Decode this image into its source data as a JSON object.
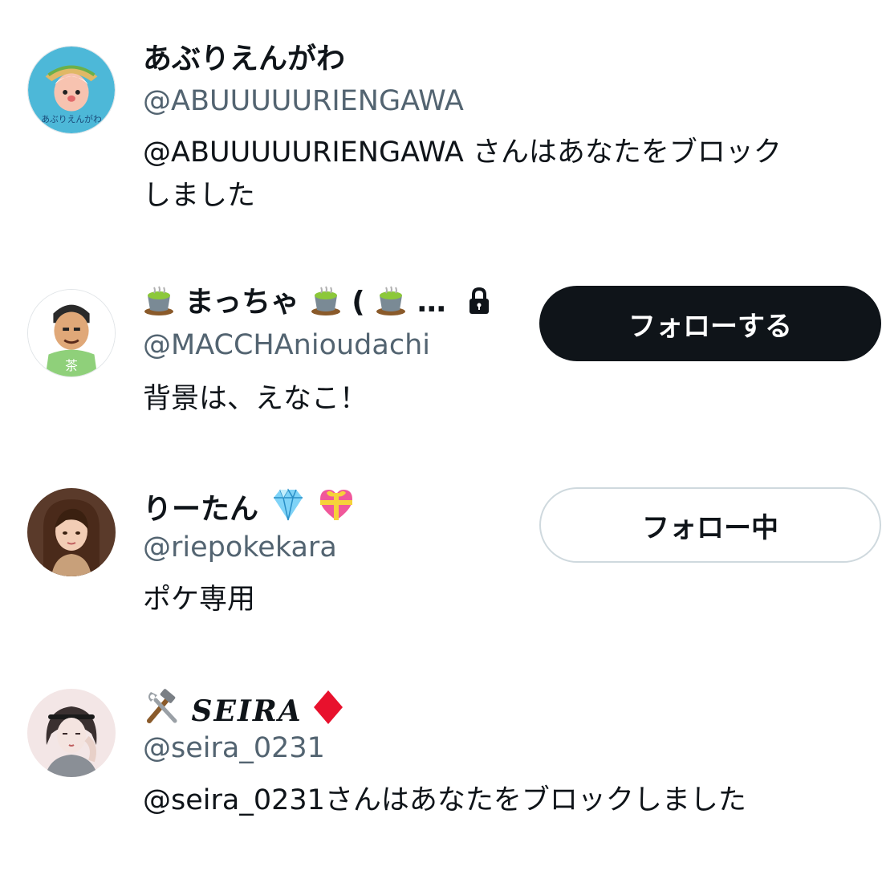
{
  "users": [
    {
      "display_name": "あぶりえんがわ",
      "handle": "@ABUUUUURIENGAWA",
      "bio_line1": "@ABUUUUURIENGAWA さんはあなたをブロック",
      "bio_line2": "しました",
      "avatar_icon": "avatar-cartoon-sushi"
    },
    {
      "display_name_parts": [
        "まっちゃ",
        "(",
        "…"
      ],
      "handle": "@MACCHAnioudachi",
      "bio": "背景は、えなこ！",
      "button_label": "フォローする",
      "icons": [
        "tea-icon",
        "lock-icon"
      ],
      "avatar_icon": "avatar-cartoon-man"
    },
    {
      "display_name": "りーたん",
      "handle": "@riepokekara",
      "bio": "ポケ専用",
      "button_label": "フォロー中",
      "icons": [
        "gem-icon",
        "heart-ribbon-icon"
      ],
      "avatar_icon": "avatar-anime-woman"
    },
    {
      "display_name": "SEIRA",
      "handle": "@seira_0231",
      "bio": "@seira_0231さんはあなたをブロックしました",
      "icons": [
        "hammer-wrench-icon",
        "diamond-suit-icon"
      ],
      "avatar_icon": "avatar-anime-girl"
    }
  ],
  "colors": {
    "primary_text": "#0f1419",
    "secondary_text": "#536471",
    "button_dark": "#0f1419",
    "button_border": "#cfd9de"
  }
}
